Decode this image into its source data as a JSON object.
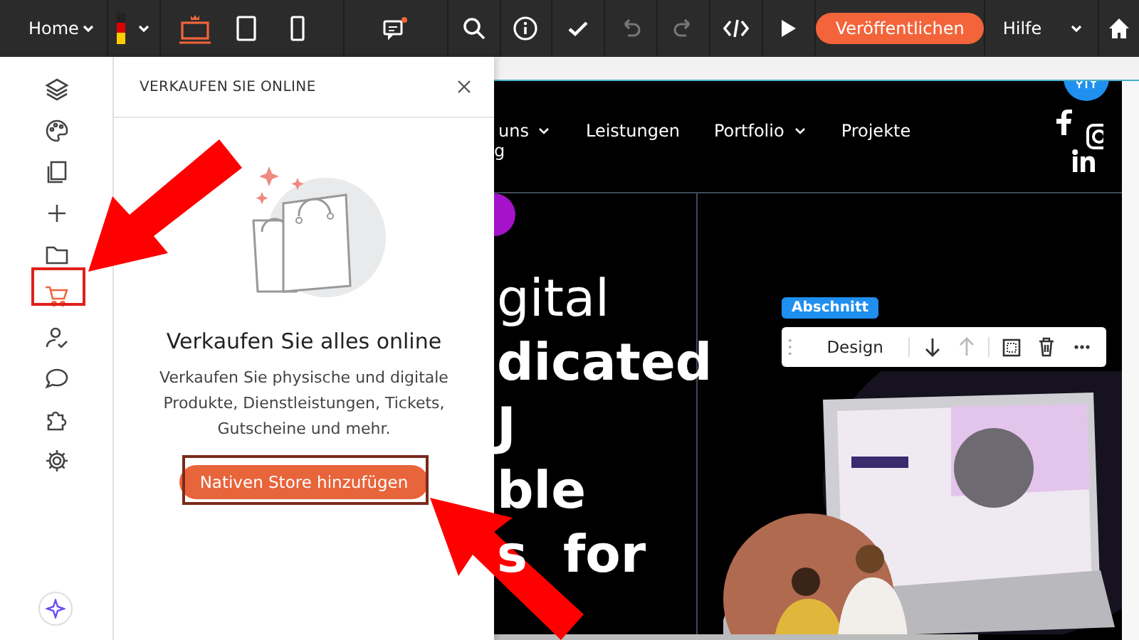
{
  "top_bar": {
    "page": "Home",
    "devices": [
      {
        "kind": "desktop",
        "selected": true
      },
      {
        "kind": "tablet",
        "selected": false
      },
      {
        "kind": "mobile",
        "selected": false
      }
    ],
    "undo_disabled": true,
    "redo_disabled": true,
    "publish": "Veröffentlichen",
    "help": "Hilfe"
  },
  "sidebar": {
    "items": [
      {
        "kind": "layers",
        "selected": false
      },
      {
        "kind": "theme",
        "selected": false
      },
      {
        "kind": "pages",
        "selected": false
      },
      {
        "kind": "add",
        "selected": false
      },
      {
        "kind": "media",
        "selected": false
      },
      {
        "kind": "store",
        "selected": true
      },
      {
        "kind": "members",
        "selected": false
      },
      {
        "kind": "chat",
        "selected": false
      },
      {
        "kind": "apps",
        "selected": false
      },
      {
        "kind": "settings",
        "selected": false
      }
    ]
  },
  "panel": {
    "title": "VERKAUFEN SIE ONLINE",
    "heading": "Verkaufen Sie alles online",
    "description": "Verkaufen Sie physische und digitale Produkte, Dienstleistungen, Tickets, Gutscheine und mehr.",
    "button": "Nativen Store hinzufügen"
  },
  "site": {
    "nav": [
      {
        "label": "uns",
        "dropdown": true
      },
      {
        "label": "Leistungen",
        "dropdown": false
      },
      {
        "label": "Portfolio",
        "dropdown": true
      },
      {
        "label": "Projekte",
        "dropdown": false
      }
    ],
    "nav_second_line": "g",
    "hero_lines": [
      {
        "text": "gital",
        "bold": false
      },
      {
        "text": "dicated",
        "bold": true
      },
      {
        "text": "J",
        "bold": true
      },
      {
        "text": "ble",
        "bold": true
      },
      {
        "text": "s  for",
        "bold": true
      }
    ],
    "section_label": "Abschnitt",
    "section_toolbar": {
      "design": "Design",
      "move_up_disabled": true
    }
  }
}
